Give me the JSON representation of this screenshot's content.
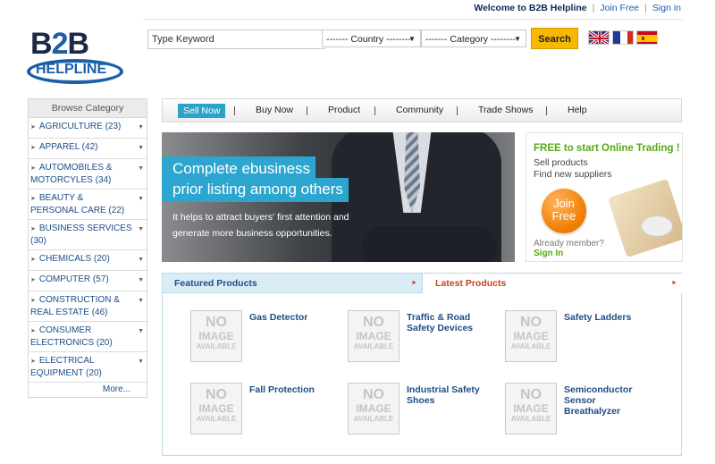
{
  "header": {
    "welcome": "Welcome to B2B Helpline",
    "join_label": "Join Free",
    "signin_label": "Sign in",
    "sep": "|"
  },
  "logo": {
    "top_b": "B",
    "top_2": "2",
    "top_b2": "B",
    "bottom": "HELPLINE"
  },
  "search": {
    "keyword_value": "Type Keyword",
    "country_label": "------- Country --------",
    "category_label": "------- Category --------",
    "button_label": "Search"
  },
  "flags": [
    "uk",
    "france",
    "spain"
  ],
  "sidebar": {
    "title": "Browse Category",
    "items": [
      {
        "label": "AGRICULTURE (23)"
      },
      {
        "label": "APPAREL (42)"
      },
      {
        "label": "AUTOMOBILES & MOTORCYLES (34)"
      },
      {
        "label": "BEAUTY & PERSONAL CARE (22)"
      },
      {
        "label": "BUSINESS SERVICES (30)"
      },
      {
        "label": "CHEMICALS (20)"
      },
      {
        "label": "COMPUTER (57)"
      },
      {
        "label": "CONSTRUCTION & REAL ESTATE (46)"
      },
      {
        "label": "CONSUMER ELECTRONICS (20)"
      },
      {
        "label": "ELECTRICAL EQUIPMENT (20)"
      }
    ],
    "more_label": "More..."
  },
  "nav": {
    "items": [
      "Sell Now",
      "Buy Now",
      "Product",
      "Community",
      "Trade Shows",
      "Help"
    ],
    "active": "Sell Now"
  },
  "banner": {
    "title_line1": "Complete ebusiness",
    "title_line2": "prior listing among others",
    "description": "It helps to attract buyers' first attention and generate more business opportunities."
  },
  "free_box": {
    "title": "FREE to start Online Trading !",
    "line1": "Sell products",
    "line2": "Find new suppliers",
    "join_line1": "Join",
    "join_line2": "Free",
    "member_text": "Already member?",
    "signin_label": "Sign In"
  },
  "products_panel": {
    "tab_featured": "Featured Products",
    "tab_latest": "Latest Products",
    "placeholder": {
      "line1": "NO",
      "line2": "IMAGE",
      "line3": "AVAILABLE"
    },
    "items": [
      {
        "name": "Gas Detector"
      },
      {
        "name": "Traffic & Road Safety Devices"
      },
      {
        "name": "Safety Ladders"
      },
      {
        "name": "Fall Protection"
      },
      {
        "name": "Industrial Safety Shoes"
      },
      {
        "name": "Semiconductor Sensor Breathalyzer"
      }
    ]
  },
  "colors": {
    "accent_blue": "#2aa3c9",
    "link_blue": "#1d4d86",
    "search_yellow": "#f6b800",
    "free_green": "#5aa81c",
    "latest_orange": "#c2441b"
  }
}
